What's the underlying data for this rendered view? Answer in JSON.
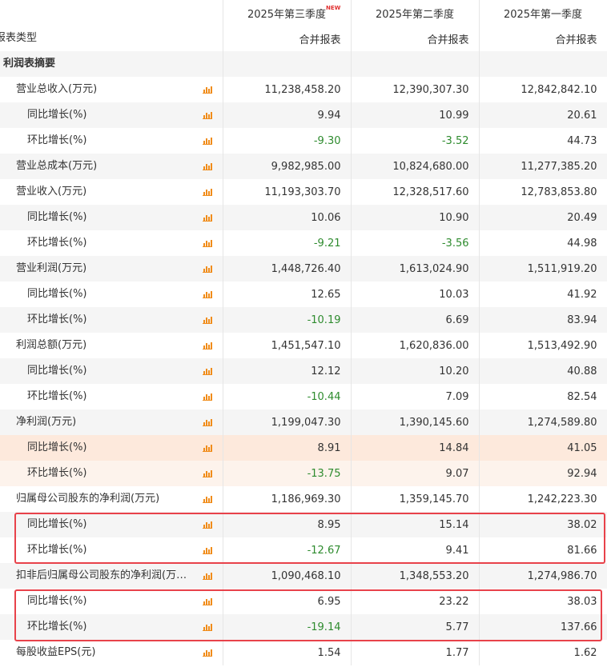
{
  "headers": {
    "q3": "2025年第三季度",
    "q3_badge": "NEW",
    "q2": "2025年第二季度",
    "q1": "2025年第一季度"
  },
  "report_type": {
    "label": "报表类型",
    "q3": "合并报表",
    "q2": "合并报表",
    "q1": "合并报表"
  },
  "section_title": "利润表摘要",
  "rows": [
    {
      "label": "营业总收入(万元)",
      "level": 0,
      "q3": "11,238,458.20",
      "q2": "12,390,307.30",
      "q1": "12,842,842.10"
    },
    {
      "label": "同比增长(%)",
      "level": 1,
      "q3": "9.94",
      "q2": "10.99",
      "q1": "20.61"
    },
    {
      "label": "环比增长(%)",
      "level": 1,
      "q3": "-9.30",
      "q2": "-3.52",
      "q1": "44.73"
    },
    {
      "label": "营业总成本(万元)",
      "level": 0,
      "q3": "9,982,985.00",
      "q2": "10,824,680.00",
      "q1": "11,277,385.20"
    },
    {
      "label": "营业收入(万元)",
      "level": 0,
      "q3": "11,193,303.70",
      "q2": "12,328,517.60",
      "q1": "12,783,853.80"
    },
    {
      "label": "同比增长(%)",
      "level": 1,
      "q3": "10.06",
      "q2": "10.90",
      "q1": "20.49"
    },
    {
      "label": "环比增长(%)",
      "level": 1,
      "q3": "-9.21",
      "q2": "-3.56",
      "q1": "44.98"
    },
    {
      "label": "营业利润(万元)",
      "level": 0,
      "q3": "1,448,726.40",
      "q2": "1,613,024.90",
      "q1": "1,511,919.20"
    },
    {
      "label": "同比增长(%)",
      "level": 1,
      "q3": "12.65",
      "q2": "10.03",
      "q1": "41.92"
    },
    {
      "label": "环比增长(%)",
      "level": 1,
      "q3": "-10.19",
      "q2": "6.69",
      "q1": "83.94"
    },
    {
      "label": "利润总额(万元)",
      "level": 0,
      "q3": "1,451,547.10",
      "q2": "1,620,836.00",
      "q1": "1,513,492.90"
    },
    {
      "label": "同比增长(%)",
      "level": 1,
      "q3": "12.12",
      "q2": "10.20",
      "q1": "40.88"
    },
    {
      "label": "环比增长(%)",
      "level": 1,
      "q3": "-10.44",
      "q2": "7.09",
      "q1": "82.54"
    },
    {
      "label": "净利润(万元)",
      "level": 0,
      "q3": "1,199,047.30",
      "q2": "1,390,145.60",
      "q1": "1,274,589.80"
    },
    {
      "label": "同比增长(%)",
      "level": 1,
      "q3": "8.91",
      "q2": "14.84",
      "q1": "41.05"
    },
    {
      "label": "环比增长(%)",
      "level": 1,
      "q3": "-13.75",
      "q2": "9.07",
      "q1": "92.94"
    },
    {
      "label": "归属母公司股东的净利润(万元)",
      "level": 0,
      "q3": "1,186,969.30",
      "q2": "1,359,145.70",
      "q1": "1,242,223.30"
    },
    {
      "label": "同比增长(%)",
      "level": 1,
      "q3": "8.95",
      "q2": "15.14",
      "q1": "38.02"
    },
    {
      "label": "环比增长(%)",
      "level": 1,
      "q3": "-12.67",
      "q2": "9.41",
      "q1": "81.66"
    },
    {
      "label": "扣非后归属母公司股东的净利润(万元)",
      "level": 0,
      "q3": "1,090,468.10",
      "q2": "1,348,553.20",
      "q1": "1,274,986.70"
    },
    {
      "label": "同比增长(%)",
      "level": 1,
      "q3": "6.95",
      "q2": "23.22",
      "q1": "38.03"
    },
    {
      "label": "环比增长(%)",
      "level": 1,
      "q3": "-19.14",
      "q2": "5.77",
      "q1": "137.66"
    },
    {
      "label": "每股收益EPS(元)",
      "level": 0,
      "q3": "1.54",
      "q2": "1.77",
      "q1": "1.62"
    }
  ],
  "colors": {
    "negative": "#2e8b2e",
    "highlight_box": "#e8424a",
    "chart_icon": "#f08c1a"
  }
}
